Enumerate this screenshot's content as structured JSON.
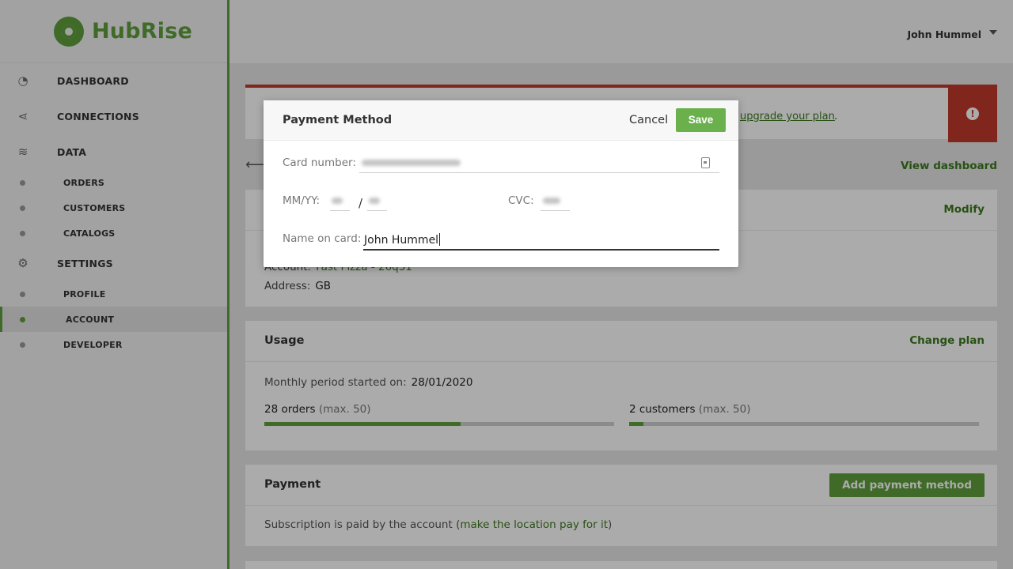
{
  "brand": {
    "name": "HubRise",
    "color": "#5e9e3c"
  },
  "user": {
    "name": "John Hummel"
  },
  "sidebar": {
    "items": [
      {
        "label": "DASHBOARD",
        "icon": "dashboard-icon"
      },
      {
        "label": "CONNECTIONS",
        "icon": "share-icon"
      },
      {
        "label": "DATA",
        "icon": "database-icon"
      },
      {
        "label": "ORDERS"
      },
      {
        "label": "CUSTOMERS"
      },
      {
        "label": "CATALOGS"
      },
      {
        "label": "SETTINGS",
        "icon": "gear-icon"
      },
      {
        "label": "PROFILE"
      },
      {
        "label": "ACCOUNT",
        "active": true
      },
      {
        "label": "DEVELOPER"
      }
    ]
  },
  "alert": {
    "link": "upgrade your plan",
    "suffix": ".",
    "color": "#c0392b",
    "icon": "exclamation-icon"
  },
  "nav": {
    "back_icon": "arrow-left-icon",
    "view_dashboard": "View dashboard"
  },
  "location": {
    "action": "Modify",
    "account_label": "Account:",
    "account_value": "Fast Pizza - 26q31",
    "address_label": "Address:",
    "address_value": "GB"
  },
  "usage": {
    "title": "Usage",
    "action": "Change plan",
    "period_label": "Monthly period started on:",
    "period_value": "28/01/2020",
    "orders": {
      "count": "28 orders",
      "max": "(max. 50)",
      "fraction": 0.56
    },
    "customers": {
      "count": "2 customers",
      "max": "(max. 50)",
      "fraction": 0.04
    }
  },
  "payment": {
    "title": "Payment",
    "action": "Add payment method",
    "text": "Subscription is paid by the account (",
    "link": "make the location pay for it",
    "text_end": ")"
  },
  "modal": {
    "title": "Payment Method",
    "cancel": "Cancel",
    "save": "Save",
    "card_number_label": "Card number:",
    "expiry_label": "MM/YY:",
    "expiry_separator": "/",
    "cvc_label": "CVC:",
    "name_label": "Name on card:",
    "name_value": "John Hummel",
    "card_icon": "contact-card-icon"
  }
}
